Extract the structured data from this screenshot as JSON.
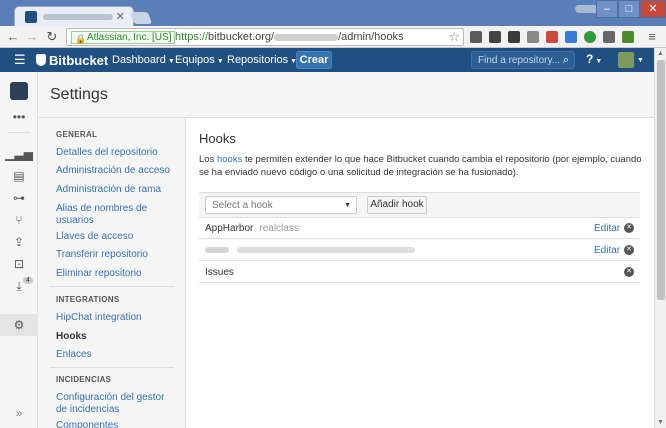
{
  "browser": {
    "ev_label": "Atlassian, Inc. [US]",
    "url_scheme": "https://",
    "url_host": "bitbucket.org/",
    "url_path": "/admin/hooks"
  },
  "header": {
    "logo": "Bitbucket",
    "nav": [
      "Dashboard",
      "Equipos",
      "Repositorios"
    ],
    "create": "Crear",
    "search_placeholder": "Find a repository..."
  },
  "page": {
    "title": "Settings"
  },
  "sidebar": {
    "sections": [
      {
        "title": "GENERAL",
        "items": [
          "Detalles del repositorio",
          "Administración de acceso",
          "Administración de rama",
          "Alias de nombres de usuarios",
          "Llaves de acceso",
          "Transferir repositorio",
          "Eliminar repositorio"
        ]
      },
      {
        "title": "INTEGRATIONS",
        "items": [
          "HipChat integration",
          "Hooks",
          "Enlaces"
        ]
      },
      {
        "title": "INCIDENCIAS",
        "items": [
          "Configuración del gestor de incidencias",
          "Componentes"
        ]
      }
    ],
    "active_item": "Hooks",
    "rail_badge": "4"
  },
  "main": {
    "heading": "Hooks",
    "desc_pre": "Los ",
    "desc_link": "hooks",
    "desc_post": " te permiten extender lo que hace Bitbucket cuando cambia el repositorio (por ejemplo, cuando se ha enviado nuevo código o una solicitud de integración se ha fusionado).",
    "select_placeholder": "Select a hook",
    "add_button": "Añadir hook",
    "hooks": [
      {
        "name": "AppHarbor",
        "detail": "realclass",
        "edit": "Editar"
      },
      {
        "name": "",
        "detail": "",
        "edit": "Editar"
      },
      {
        "name": "Issues",
        "detail": "",
        "edit": ""
      }
    ]
  }
}
